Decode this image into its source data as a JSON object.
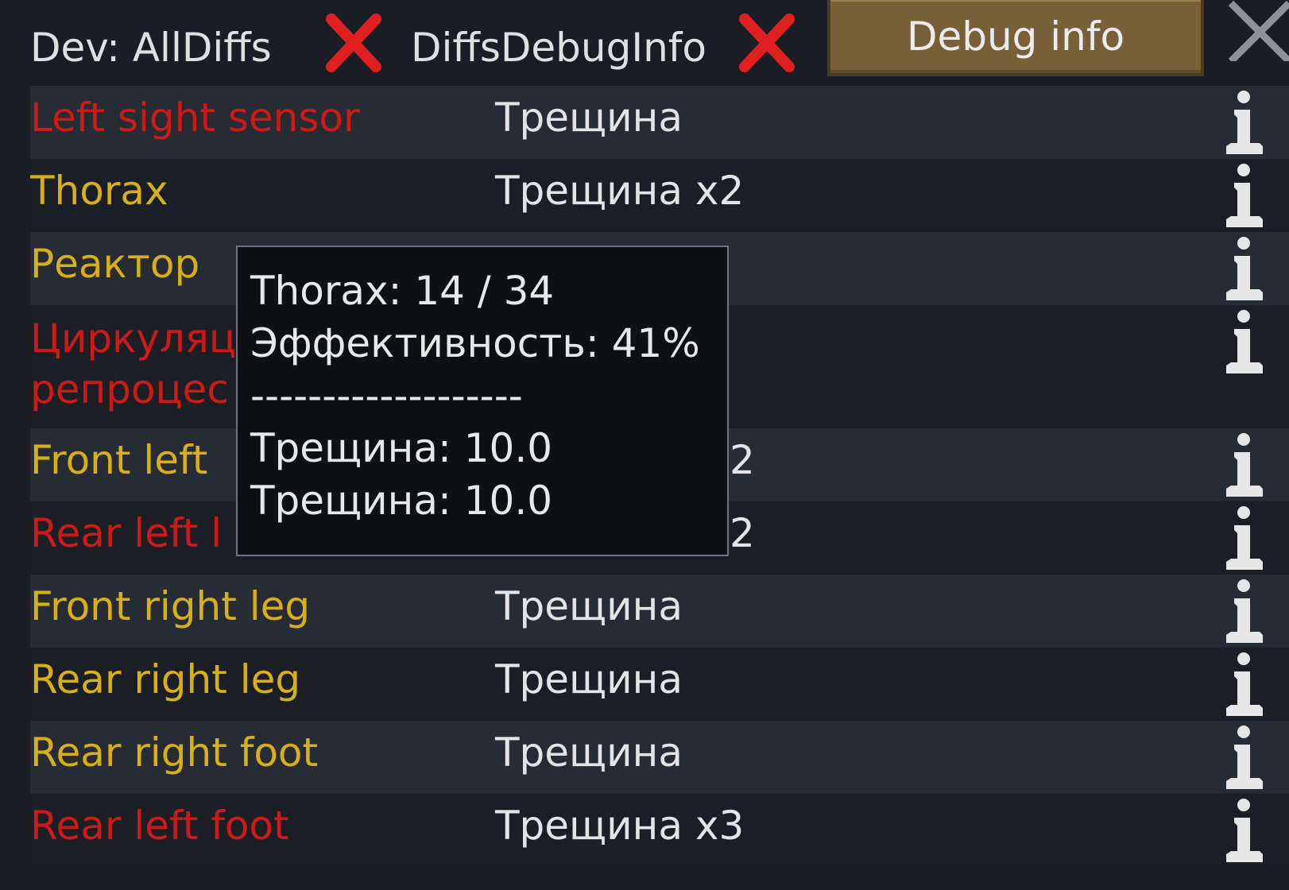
{
  "topbar": {
    "toggle1_label": "Dev: AllDiffs",
    "toggle2_label": "DiffsDebugInfo",
    "debug_button_label": "Debug info"
  },
  "colors": {
    "bad_part": "#cc1a17",
    "damaged_part": "#d7af16",
    "toggle_off": "#e02020",
    "button_brown": "#786138"
  },
  "rows": [
    {
      "part": "Left sight sensor",
      "injury": "Трещина",
      "color": "red"
    },
    {
      "part": "Thorax",
      "injury": "Трещина x2",
      "color": "yellow"
    },
    {
      "part": "Реактор",
      "injury": "",
      "color": "yellow"
    },
    {
      "part": "Циркуляц репроцес",
      "injury": "",
      "color": "red"
    },
    {
      "part": "Front left",
      "injury": "2",
      "color": "yellow"
    },
    {
      "part": "Rear left l",
      "injury": "2",
      "color": "red"
    },
    {
      "part": "Front right leg",
      "injury": "Трещина",
      "color": "yellow"
    },
    {
      "part": "Rear right leg",
      "injury": "Трещина",
      "color": "yellow"
    },
    {
      "part": "Rear right foot",
      "injury": "Трещина",
      "color": "yellow"
    },
    {
      "part": "Rear left foot",
      "injury": "Трещина x3",
      "color": "red"
    }
  ],
  "tooltip": {
    "line1": "Thorax:  14 / 34",
    "line2": "Эффективность: 41%",
    "separator": "-------------------",
    "line3": "Трещина: 10.0",
    "line4": "Трещина: 10.0"
  },
  "icons": {
    "toggle_off": "red-x-icon",
    "close": "close-icon",
    "info": "info-icon"
  }
}
